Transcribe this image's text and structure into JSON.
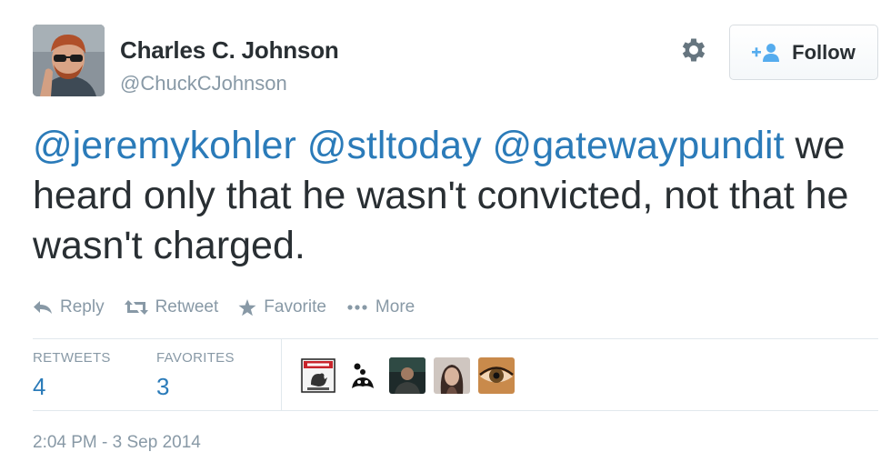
{
  "author": {
    "name": "Charles C. Johnson",
    "handle": "@ChuckCJohnson"
  },
  "follow_button": {
    "label": "Follow"
  },
  "tweet": {
    "mentions": [
      "@jeremykohler",
      "@stltoday",
      "@gatewaypundit"
    ],
    "body": "we heard only that he wasn't convicted, not that he wasn't charged."
  },
  "actions": {
    "reply": "Reply",
    "retweet": "Retweet",
    "favorite": "Favorite",
    "more": "More"
  },
  "stats": {
    "retweets_label": "RETWEETS",
    "retweets": "4",
    "favorites_label": "FAVORITES",
    "favorites": "3"
  },
  "favoriters": [
    {
      "icon": "caution-sign-avatar"
    },
    {
      "icon": "bird-avatar"
    },
    {
      "icon": "person-avatar"
    },
    {
      "icon": "woman-avatar"
    },
    {
      "icon": "eye-avatar"
    }
  ],
  "timestamp": "2:04 PM - 3 Sep 2014",
  "colors": {
    "link": "#2b7bb9",
    "text": "#292f33",
    "muted": "#8899a6",
    "border": "#e1e8ed"
  }
}
